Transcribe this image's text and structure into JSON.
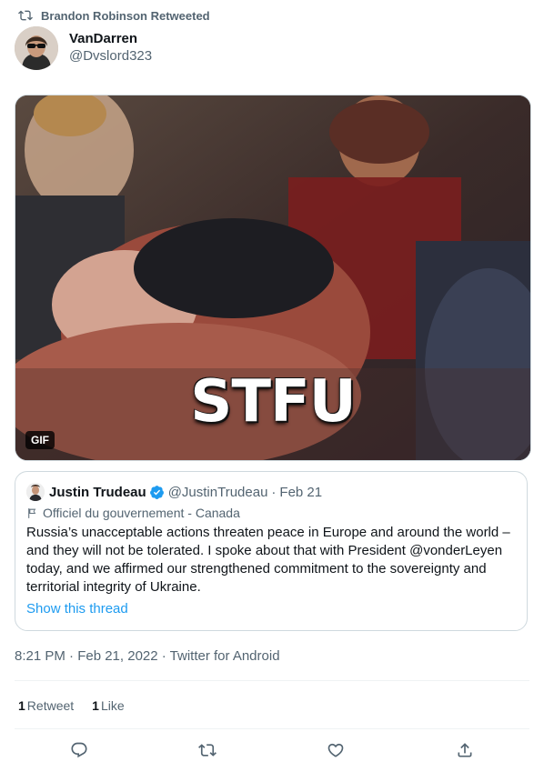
{
  "retweet_header": {
    "text": "Brandon Robinson Retweeted",
    "icon": "retweet-icon"
  },
  "author": {
    "display_name": "VanDarren",
    "handle": "@Dvslord323"
  },
  "media": {
    "type_badge": "GIF",
    "caption": "STFU"
  },
  "quoted_tweet": {
    "name": "Justin Trudeau",
    "handle": "@JustinTrudeau",
    "separator": "·",
    "date": "Feb 21",
    "label": "Officiel du gouvernement - Canada",
    "text": "Russia’s unacceptable actions threaten peace in Europe and around the world – and they will not be tolerated. I spoke about that with President @vonderLeyen today, and we affirmed our strengthened commitment to the sovereignty and territorial integrity of Ukraine.",
    "show_thread": "Show this thread"
  },
  "timestamp": "8:21 PM · Feb 21, 2022 · Twitter for Android",
  "stats": {
    "retweets_count": "1",
    "retweets_label": "Retweet",
    "likes_count": "1",
    "likes_label": "Like"
  },
  "actions": [
    "reply-icon",
    "retweet-icon",
    "like-icon",
    "share-icon"
  ],
  "colors": {
    "accent": "#1d9bf0",
    "secondary_text": "#536471",
    "border": "#cfd9de"
  }
}
